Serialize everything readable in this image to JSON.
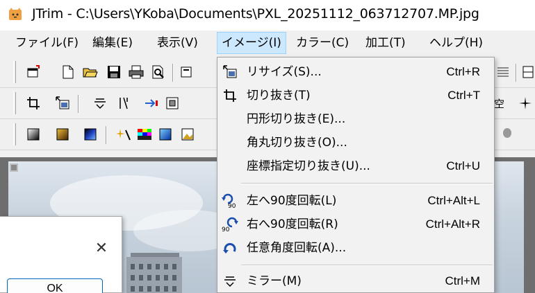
{
  "window": {
    "title": "JTrim - C:\\Users\\YKoba\\Documents\\PXL_20251112_063712707.MP.jpg"
  },
  "menubar": {
    "items": [
      {
        "label": "ファイル(F)"
      },
      {
        "label": "編集(E)"
      },
      {
        "label": "表示(V)"
      },
      {
        "label": "イメージ(I)"
      },
      {
        "label": "カラー(C)"
      },
      {
        "label": "加工(T)"
      },
      {
        "label": "ヘルプ(H)"
      }
    ],
    "active": "イメージ(I)"
  },
  "image_menu": {
    "items": [
      {
        "icon": "resize-icon",
        "label": "リサイズ(S)...",
        "shortcut": "Ctrl+R"
      },
      {
        "icon": "crop-icon",
        "label": "切り抜き(T)",
        "shortcut": "Ctrl+T"
      },
      {
        "icon": "",
        "label": "円形切り抜き(E)...",
        "shortcut": ""
      },
      {
        "icon": "",
        "label": "角丸切り抜き(O)...",
        "shortcut": ""
      },
      {
        "icon": "",
        "label": "座標指定切り抜き(U)...",
        "shortcut": "Ctrl+U"
      },
      {
        "icon": "rotate-left-90-icon",
        "label": "左へ90度回転(L)",
        "shortcut": "Ctrl+Alt+L"
      },
      {
        "icon": "rotate-right-90-icon",
        "label": "右へ90度回転(R)",
        "shortcut": "Ctrl+Alt+R"
      },
      {
        "icon": "rotate-any-icon",
        "label": "任意角度回転(A)...",
        "shortcut": ""
      },
      {
        "icon": "mirror-icon",
        "label": "ミラー(M)",
        "shortcut": "Ctrl+M"
      }
    ]
  },
  "toolbar_icons": {
    "row1": [
      "new-window-icon",
      "new-file-icon",
      "open-folder-icon",
      "save-icon",
      "print-icon",
      "print-preview-icon"
    ],
    "row2": [
      "crop-icon",
      "resize-icon",
      "mirror-icon",
      "flip-icon",
      "arrow-icon",
      "frame-icon"
    ],
    "row3": [
      "gradient-gray-icon",
      "gradient-sepia-icon",
      "gradient-blue-icon",
      "sparkle-icon",
      "color-palette-icon",
      "blue-square-icon",
      "image-icon"
    ]
  },
  "dialog": {
    "close_glyph": "✕",
    "ok_label": "OK"
  },
  "colors": {
    "menu_highlight": "#cce8ff",
    "menu_bg": "#f2f2f2",
    "workspace": "#6e6e6e"
  }
}
